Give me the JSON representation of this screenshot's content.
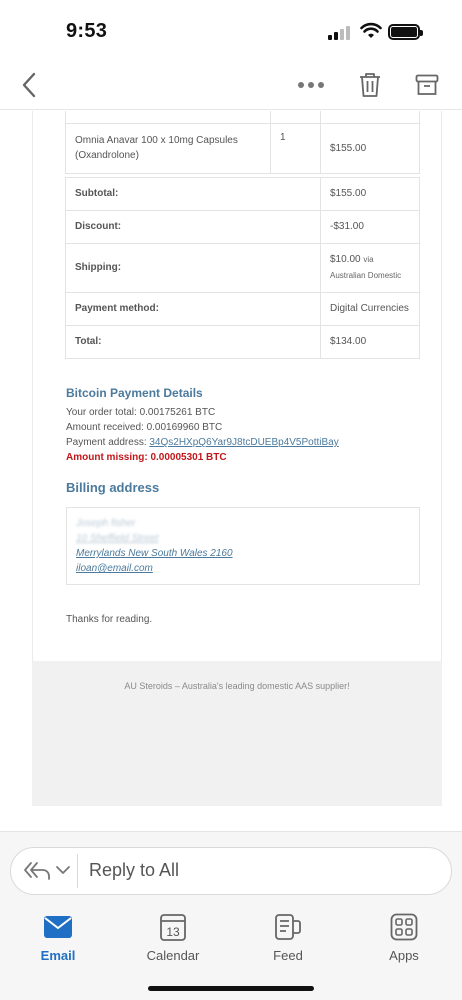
{
  "status_bar": {
    "time": "9:53"
  },
  "order": {
    "items": [
      {
        "product": "Omnia Anavar 100 x 10mg Capsules (Oxandrolone)",
        "quantity": "1",
        "price": "$155.00"
      }
    ],
    "subtotal_label": "Subtotal:",
    "subtotal": "$155.00",
    "discount_label": "Discount:",
    "discount": "-$31.00",
    "shipping_label": "Shipping:",
    "shipping": "$10.00",
    "shipping_via": "via",
    "shipping_method": "Australian Domestic",
    "payment_label": "Payment method:",
    "payment": "Digital Currencies",
    "total_label": "Total:",
    "total": "$134.00"
  },
  "bitcoin": {
    "title": "Bitcoin Payment Details",
    "order_total": "Your order total: 0.00175261 BTC",
    "amount_received": "Amount received: 0.00169960 BTC",
    "address_label": "Payment address: ",
    "address": "34Qs2HXpQ6Yar9J8tcDUEBp4V5PottiBay",
    "amount_missing": "Amount missing: 0.00005301 BTC"
  },
  "billing": {
    "title": "Billing address",
    "name": "Joseph fisher",
    "street": "10 Sheffield Street",
    "city": "Merrylands New South Wales 2160",
    "email": "iloan@email.com"
  },
  "thanks": "Thanks for reading.",
  "footer": "AU Steroids – Australia's leading domestic AAS supplier!",
  "reply_bar": {
    "label": "Reply to All"
  },
  "tabs": [
    {
      "label": "Email"
    },
    {
      "label": "Calendar"
    },
    {
      "label": "Feed"
    },
    {
      "label": "Apps"
    }
  ],
  "calendar_day": "13",
  "colors": {
    "accent": "#1f6fc5",
    "link": "#4b7a9c",
    "alert": "#c0171b"
  }
}
